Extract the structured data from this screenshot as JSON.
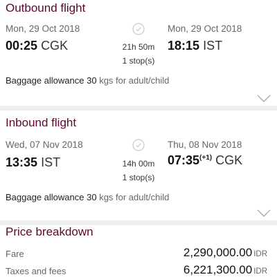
{
  "outbound": {
    "title": "Outbound flight",
    "depart_date": "Mon, 29 Oct 2018",
    "arrive_date": "Mon, 29 Oct 2018",
    "depart_time": "00:25",
    "depart_code": "CGK",
    "arrive_time": "18:15",
    "arrive_code": "IST",
    "duration": "21h 50m",
    "stops": "1 stop(s)",
    "baggage_prefix": "Baggage allowance 30",
    "baggage_suffix": "kgs for adult/child",
    "icons": [
      "clock-icon",
      "chevron-down-icon"
    ]
  },
  "inbound": {
    "title": "Inbound flight",
    "depart_date": "Wed, 07 Nov 2018",
    "arrive_date": "Thu, 08 Nov 2018",
    "depart_time": "13:35",
    "depart_code": "IST",
    "arrive_time": "07:35",
    "arrive_offset": "(+1)",
    "arrive_code": "CGK",
    "duration": "14h 00m",
    "stops": "1 stop(s)",
    "baggage_prefix": "Baggage allowance 30",
    "baggage_suffix": "kgs for adult/child",
    "icons": [
      "clock-icon",
      "chevron-down-icon"
    ]
  },
  "price": {
    "title": "Price breakdown",
    "rows": [
      {
        "label": "Fare",
        "amount": "2,290,000.00",
        "currency": "IDR"
      },
      {
        "label": "Taxes and fees",
        "amount": "6,221,300.00",
        "currency": "IDR"
      }
    ]
  },
  "colors": {
    "accent": "#5c0632",
    "divider": "#eeeeee",
    "muted": "#666666"
  }
}
